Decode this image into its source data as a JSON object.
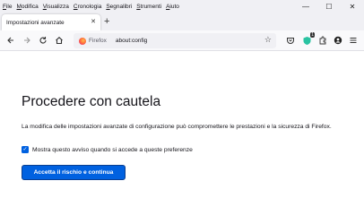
{
  "menubar": {
    "items": [
      {
        "first": "F",
        "rest": "ile"
      },
      {
        "first": "M",
        "rest": "odifica"
      },
      {
        "first": "V",
        "rest": "isualizza"
      },
      {
        "first": "C",
        "rest": "ronologia"
      },
      {
        "first": "S",
        "rest": "egnalibri"
      },
      {
        "first": "S",
        "rest": "trumenti"
      },
      {
        "first": "A",
        "rest": "iuto"
      }
    ]
  },
  "window_controls": {
    "minimize": "—",
    "maximize": "☐",
    "close": "✕"
  },
  "tab": {
    "title": "Impostazioni avanzate",
    "close": "✕"
  },
  "newtab": "+",
  "navbar": {
    "identity_label": "Firefox",
    "url": "about:config",
    "icons": [
      "back-icon",
      "forward-icon",
      "reload-icon",
      "home-icon",
      "bookmark-star-icon",
      "pocket-icon",
      "extension-icon",
      "account-icon",
      "menu-icon"
    ],
    "extension_badge": "1"
  },
  "page": {
    "title": "Procedere con cautela",
    "description": "La modifica delle impostazioni avanzate di configurazione può compromettere le prestazioni e la sicurezza di Firefox.",
    "checkbox_label": "Mostra questo avviso quando si accede a queste preferenze",
    "checkbox_checked": true,
    "accept_button": "Accetta il rischio e continua"
  },
  "colors": {
    "accent": "#0061e0",
    "toolbar": "#f9f9fb",
    "tabstrip": "#f0f0f4"
  }
}
